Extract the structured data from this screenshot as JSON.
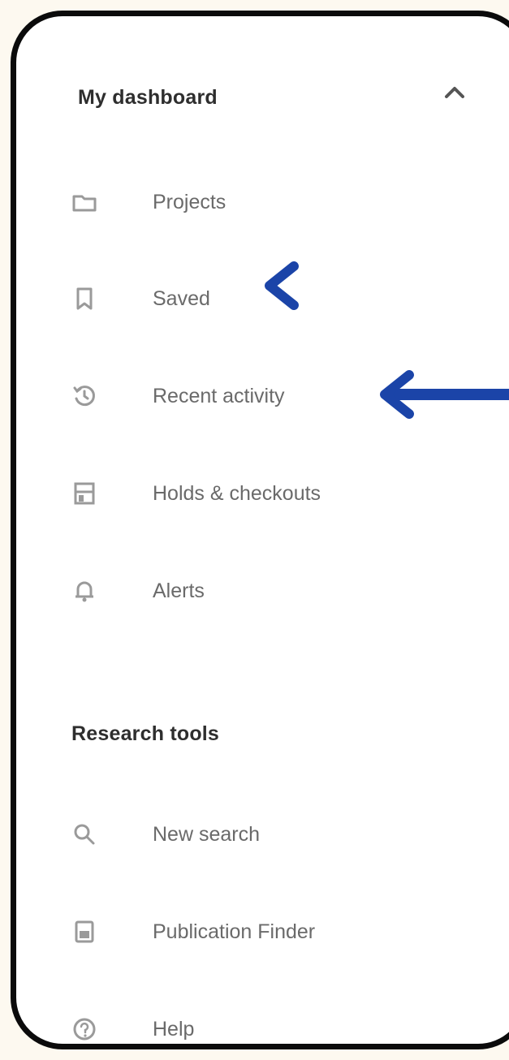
{
  "dashboard": {
    "title": "My dashboard",
    "items": [
      {
        "label": "Projects",
        "icon": "folder-icon"
      },
      {
        "label": "Saved",
        "icon": "bookmark-icon"
      },
      {
        "label": "Recent activity",
        "icon": "history-icon"
      },
      {
        "label": "Holds & checkouts",
        "icon": "books-icon"
      },
      {
        "label": "Alerts",
        "icon": "bell-icon"
      }
    ]
  },
  "research": {
    "title": "Research tools",
    "items": [
      {
        "label": "New search",
        "icon": "search-icon"
      },
      {
        "label": "Publication Finder",
        "icon": "publication-icon"
      },
      {
        "label": "Help",
        "icon": "help-icon"
      }
    ]
  },
  "colors": {
    "arrow_blue": "#1b44a8",
    "arrow_purple": "#7f53c9",
    "frame": "#0b0b0b",
    "background": "#fdf9f0"
  }
}
